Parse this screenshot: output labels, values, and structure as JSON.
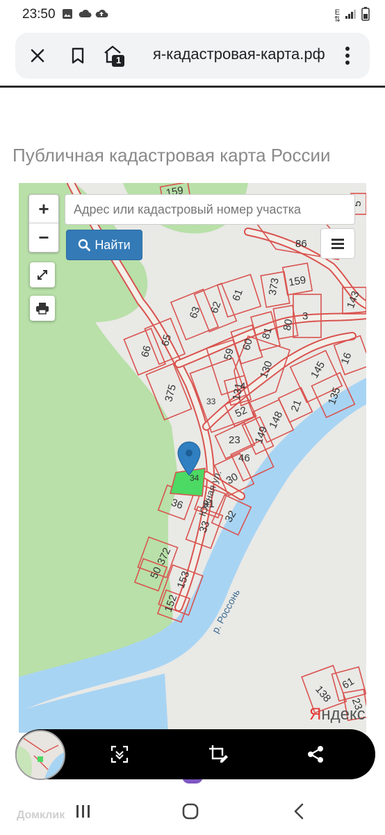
{
  "status_bar": {
    "time": "23:50",
    "icons_left": [
      "gallery-icon",
      "cloud-icon",
      "cloud-upload-icon"
    ],
    "icons_right": [
      "data-arrows-icon",
      "signal-icon",
      "battery-icon"
    ],
    "network_label": "E"
  },
  "browser": {
    "url": "я-кадастровая-карта.рф",
    "tab_count": "1",
    "icons": [
      "close-icon",
      "bookmark-icon",
      "tab-icon",
      "more-vert-icon"
    ]
  },
  "page": {
    "title": "Публичная кадастровая карта России"
  },
  "map": {
    "search_placeholder": "Адрес или кадастровый номер участка",
    "find_label": "Найти",
    "zoom_in": "+",
    "zoom_out": "−",
    "street_label": "Южная ул.",
    "river_label": "р. Россонь",
    "attribution": "Яндекс",
    "parcels": [
      "159",
      "86",
      "5",
      "373",
      "159",
      "61",
      "62",
      "63",
      "143",
      "3",
      "80",
      "81",
      "60",
      "65",
      "66",
      "59",
      "130",
      "145",
      "16",
      "135",
      "131",
      "4",
      "33",
      "375",
      "21",
      "52",
      "148",
      "23",
      "149",
      "46",
      "30",
      "34",
      "36",
      "91",
      "32",
      "33",
      "372",
      "50",
      "153",
      "152",
      "138",
      "61",
      "23"
    ],
    "colors": {
      "land": "#e9e9e6",
      "forest": "#b8e0a8",
      "water": "#a8d4f3",
      "parcel": "#d9534f",
      "selected": "#4cd964"
    }
  },
  "capture_toolbar": {
    "icons": [
      "scroll-capture-icon",
      "crop-edit-icon",
      "share-icon"
    ]
  },
  "footer": {
    "watermark": "Домклик"
  },
  "nav_bar": {
    "icons": [
      "recents-icon",
      "home-icon",
      "back-icon"
    ]
  }
}
